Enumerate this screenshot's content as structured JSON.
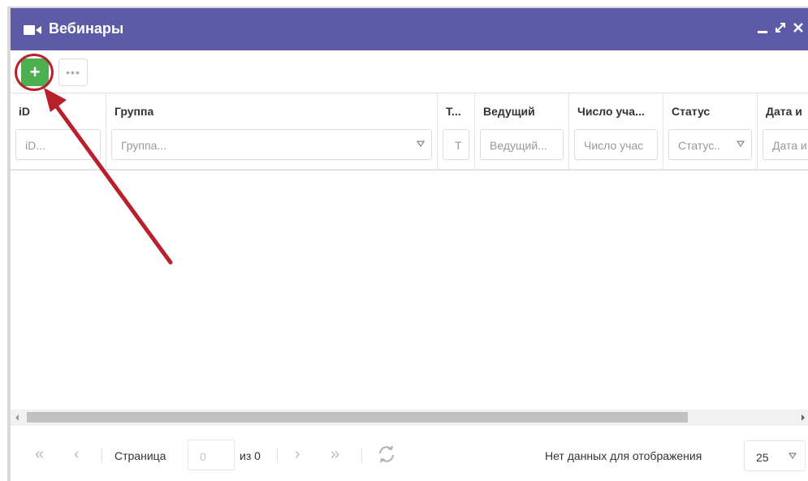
{
  "window": {
    "title": "Вебинары",
    "title_icon": "video-camera-icon",
    "controls": [
      "minimize-icon",
      "maximize-icon",
      "close-icon"
    ],
    "accent_color": "#5d5aa8"
  },
  "toolbar": {
    "add_label": "+",
    "more_label": "•••",
    "add_color": "#4caf50",
    "highlight_color": "#b8202a"
  },
  "columns": [
    {
      "header": "iD",
      "filter_placeholder": "iD..."
    },
    {
      "header": "Группа",
      "filter_placeholder": "Группа..."
    },
    {
      "header": "Т...",
      "filter_placeholder": "Т"
    },
    {
      "header": "Ведущий",
      "filter_placeholder": "Ведущий..."
    },
    {
      "header": "Число уча...",
      "filter_placeholder": "Число учас"
    },
    {
      "header": "Статус",
      "filter_placeholder": "Статус.."
    },
    {
      "header": "Дата и",
      "filter_placeholder": "Дата и"
    }
  ],
  "pager": {
    "page_label": "Страница",
    "page_value": "0",
    "of_label": "из 0",
    "status": "Нет данных для отображения",
    "page_size": "25"
  }
}
